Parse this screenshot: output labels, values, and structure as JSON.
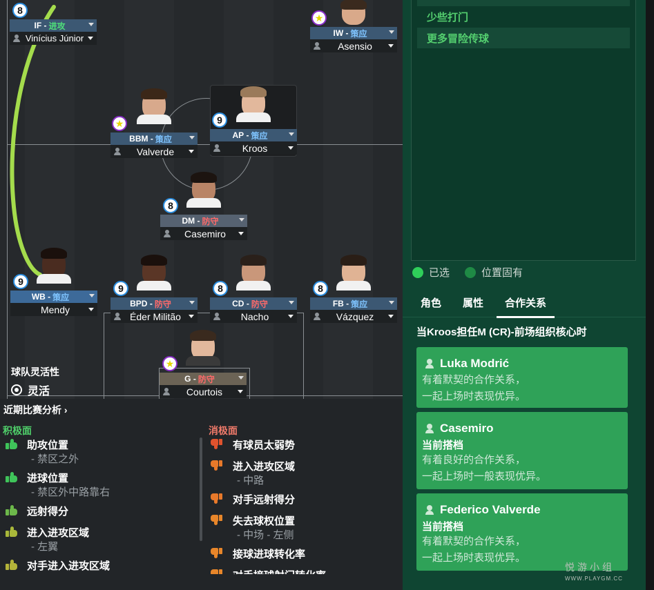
{
  "pitch": {
    "team_flexibility": {
      "label": "球队灵活性",
      "value": "灵活"
    },
    "players": {
      "if": {
        "rating": "8",
        "role": "IF",
        "duty": "进攻",
        "name": "Vinícius Júnior"
      },
      "iw": {
        "role": "IW",
        "duty": "策应",
        "name": "Asensio"
      },
      "bbm": {
        "role": "BBM",
        "duty": "策应",
        "name": "Valverde"
      },
      "ap": {
        "rating": "9",
        "role": "AP",
        "duty": "策应",
        "name": "Kroos"
      },
      "dm": {
        "rating": "8",
        "role": "DM",
        "duty": "防守",
        "name": "Casemiro"
      },
      "wb": {
        "rating": "9",
        "role": "WB",
        "duty": "策应",
        "name": "Mendy"
      },
      "bpd": {
        "rating": "9",
        "role": "BPD",
        "duty": "防守",
        "name": "Éder Militão"
      },
      "cd": {
        "rating": "8",
        "role": "CD",
        "duty": "防守",
        "name": "Nacho"
      },
      "fb": {
        "rating": "8",
        "role": "FB",
        "duty": "策应",
        "name": "Vázquez"
      },
      "gk": {
        "role": "G",
        "duty": "防守",
        "name": "Courtois"
      }
    }
  },
  "analysis": {
    "title": "近期比赛分析 ›",
    "positive": {
      "heading": "积极面",
      "items": [
        {
          "label": "助攻位置",
          "sub": "- 禁区之外"
        },
        {
          "label": "进球位置",
          "sub": "- 禁区外中路靠右"
        },
        {
          "label": "远射得分"
        },
        {
          "label": "进入进攻区域",
          "sub": "- 左翼"
        },
        {
          "label": "对手进入进攻区域"
        }
      ]
    },
    "negative": {
      "heading": "消极面",
      "items": [
        {
          "label": "有球员太弱势"
        },
        {
          "label": "进入进攻区域",
          "sub": "- 中路"
        },
        {
          "label": "对手远射得分"
        },
        {
          "label": "失去球权位置",
          "sub": "- 中场 - 左侧"
        },
        {
          "label": "接球进球转化率"
        },
        {
          "label": "对手接球射门转化率"
        }
      ]
    }
  },
  "right_panel": {
    "instructions": [
      "少些打门",
      "更多冒险传球"
    ],
    "legend": {
      "selected": "已选",
      "fixed": "位置固有"
    },
    "tabs": {
      "role": "角色",
      "attributes": "属性",
      "partnerships": "合作关系"
    },
    "context": "当Kroos担任M (CR)-前场组织核心时",
    "cards": [
      {
        "name": "Luka Modrić",
        "desc1": "有着默契的合作关系，",
        "desc2": "一起上场时表现优异。"
      },
      {
        "name": "Casemiro",
        "status": "当前搭档",
        "desc1": "有着良好的合作关系，",
        "desc2": "一起上场时一般表现优异。"
      },
      {
        "name": "Federico Valverde",
        "status": "当前搭档",
        "desc1": "有着默契的合作关系，",
        "desc2": "一起上场时表现优异。"
      }
    ],
    "watermark": {
      "text": "悦游小组",
      "url": "WWW.PLAYGM.CC"
    }
  },
  "colors": {
    "accent_green": "#2fa258",
    "support_blue": "#7fc4ff",
    "defend_red": "#ff6a6a",
    "attack_green": "#4fe07a"
  }
}
